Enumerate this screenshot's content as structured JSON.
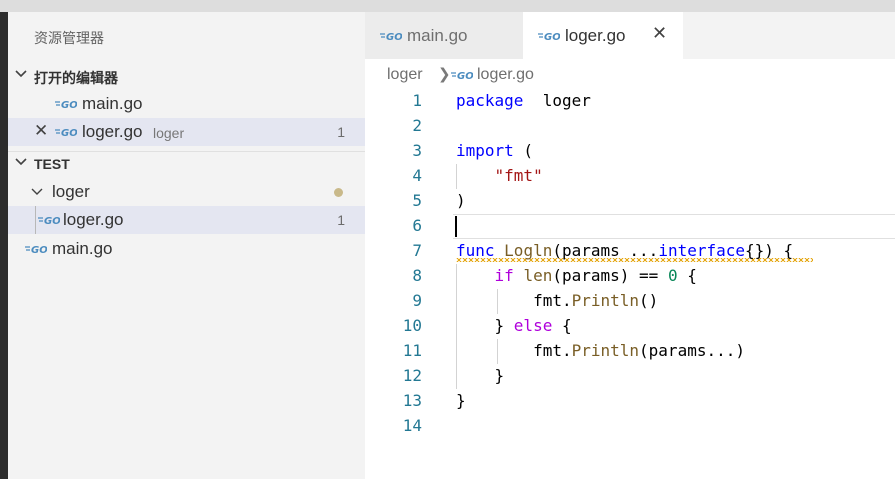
{
  "sidebar": {
    "title": "资源管理器",
    "open_editors": {
      "header": "打开的编辑器",
      "items": [
        {
          "name": "main.go",
          "desc": "",
          "count": ""
        },
        {
          "name": "loger.go",
          "desc": "loger",
          "count": "1"
        }
      ]
    },
    "workspace": {
      "header": "TEST",
      "folder": "loger",
      "folder_files": [
        {
          "name": "loger.go",
          "count": "1"
        }
      ],
      "root_files": [
        {
          "name": "main.go"
        }
      ]
    }
  },
  "tabs": [
    {
      "label": "main.go",
      "active": false
    },
    {
      "label": "loger.go",
      "active": true
    }
  ],
  "breadcrumb": {
    "folder": "loger",
    "file": "loger.go"
  },
  "editor": {
    "line_numbers": [
      "1",
      "2",
      "3",
      "4",
      "5",
      "6",
      "7",
      "8",
      "9",
      "10",
      "11",
      "12",
      "13",
      "14"
    ],
    "code": [
      [
        [
          "kw",
          "package"
        ],
        [
          "",
          "  loger"
        ]
      ],
      [],
      [
        [
          "kw",
          "import"
        ],
        [
          "",
          " ("
        ]
      ],
      [
        [
          "",
          "    "
        ],
        [
          "str",
          "\"fmt\""
        ]
      ],
      [
        [
          "",
          ")"
        ]
      ],
      [],
      [
        [
          "kw",
          "func"
        ],
        [
          "",
          " "
        ],
        [
          "fn",
          "Logln"
        ],
        [
          "",
          "(params ..."
        ],
        [
          "kw",
          "interface"
        ],
        [
          "",
          "{}) {"
        ]
      ],
      [
        [
          "",
          "    "
        ],
        [
          "ctl",
          "if"
        ],
        [
          "",
          " "
        ],
        [
          "fn",
          "len"
        ],
        [
          "",
          "(params) == "
        ],
        [
          "num-lit",
          "0"
        ],
        [
          "",
          " {"
        ]
      ],
      [
        [
          "",
          "        fmt."
        ],
        [
          "fn",
          "Println"
        ],
        [
          "",
          "()"
        ]
      ],
      [
        [
          "",
          "    } "
        ],
        [
          "ctl",
          "else"
        ],
        [
          "",
          " {"
        ]
      ],
      [
        [
          "",
          "        fmt."
        ],
        [
          "fn",
          "Println"
        ],
        [
          "",
          "(params...)"
        ]
      ],
      [
        [
          "",
          "    }"
        ]
      ],
      [
        [
          "",
          "}"
        ]
      ],
      []
    ]
  },
  "colors": {
    "keyword": "#0000ff",
    "control": "#af00db",
    "function": "#795e26",
    "string": "#a31515",
    "number": "#098658",
    "line_number": "#237893",
    "go_icon": "#4c8cbf",
    "sidebar_bg": "#f3f3f3",
    "selection_bg": "#e4e6f1"
  },
  "icons": [
    "go-file-icon",
    "close-icon",
    "chevron-down-icon",
    "chevron-right-icon",
    "modified-dot-icon"
  ]
}
